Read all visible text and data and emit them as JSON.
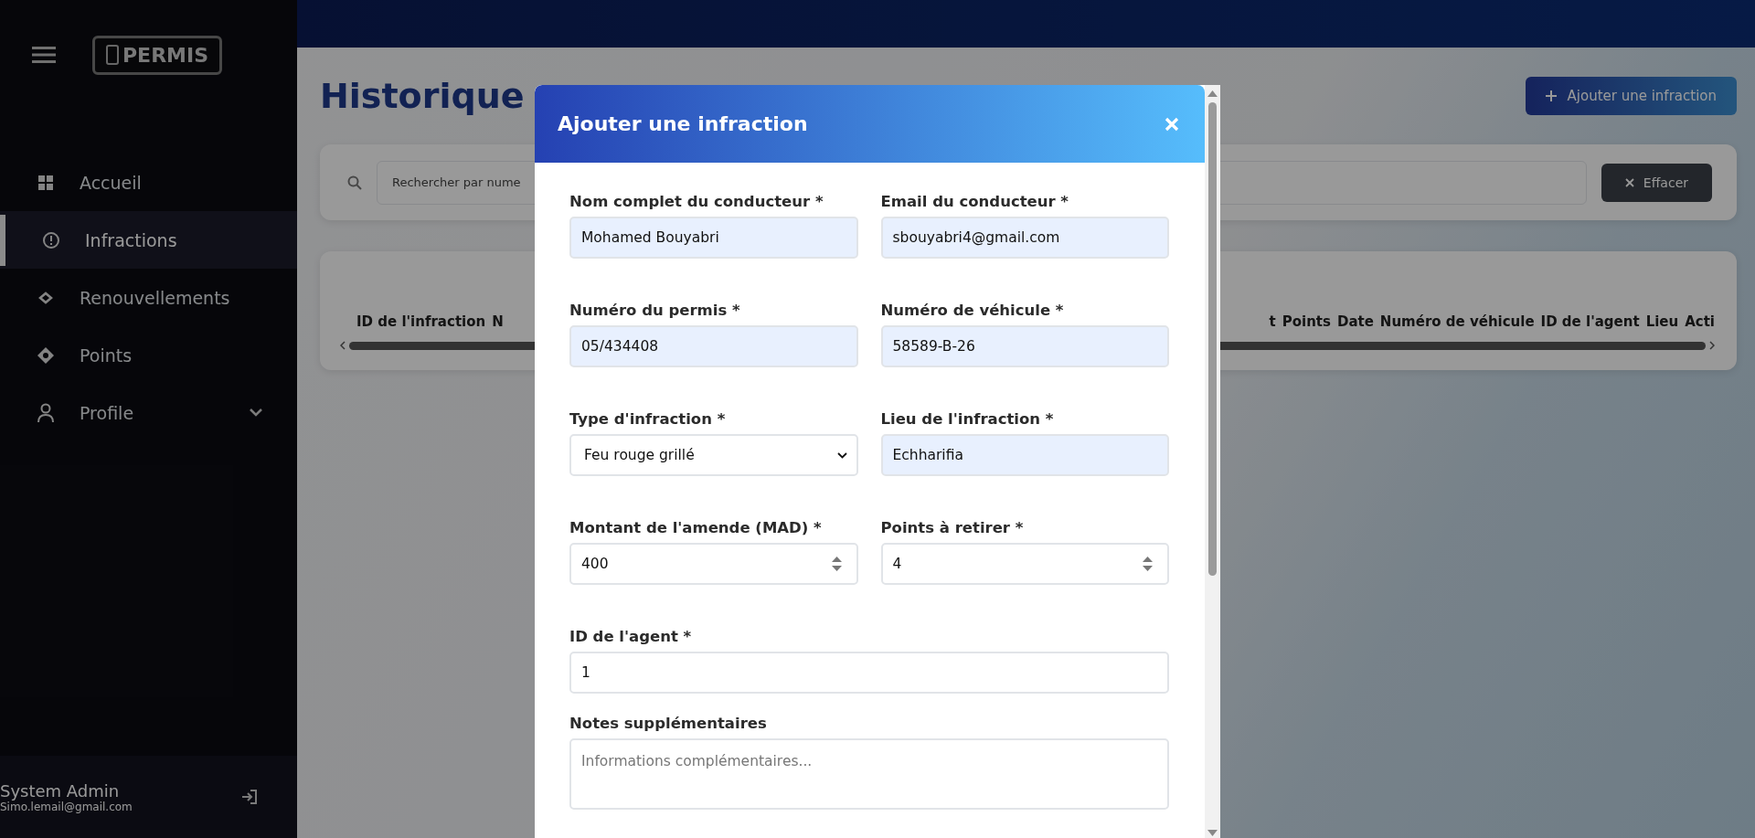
{
  "sidebar": {
    "logo": "PERMIS",
    "items": [
      {
        "label": "Accueil",
        "kind": "link",
        "selected": false
      },
      {
        "label": "Infractions",
        "kind": "link",
        "selected": true
      },
      {
        "label": "Renouvellements",
        "kind": "link",
        "selected": false
      },
      {
        "label": "Points",
        "kind": "link",
        "selected": false
      },
      {
        "label": "Profile",
        "kind": "submenu",
        "selected": false
      }
    ],
    "user": {
      "name": "System Admin",
      "email": "Simo.lemail@gmail.com"
    }
  },
  "page": {
    "title": "Historique",
    "add_button": "Ajouter une infraction",
    "search_placeholder": "Rechercher par nume",
    "clear_button": "Effacer",
    "table": {
      "columns_left": [
        "ID de l'infraction",
        "N"
      ],
      "columns_right": [
        "t",
        "Points",
        "Date",
        "Numéro de véhicule",
        "ID de l'agent",
        "Lieu",
        "Acti"
      ]
    }
  },
  "dialog": {
    "title": "Ajouter une infraction",
    "rows": [
      [
        {
          "label": "Nom complet du conducteur *",
          "kind": "text",
          "value": "Mohamed Bouyabri",
          "autofilled": true
        },
        {
          "label": "Email du conducteur *",
          "kind": "text",
          "value": "sbouyabri4@gmail.com",
          "autofilled": true
        }
      ],
      [
        {
          "label": "Numéro du permis *",
          "kind": "text",
          "value": "05/434408",
          "autofilled": true
        },
        {
          "label": "Numéro de véhicule *",
          "kind": "text",
          "value": "58589-B-26",
          "autofilled": true
        }
      ],
      [
        {
          "label": "Type d'infraction *",
          "kind": "select",
          "value": "Feu rouge grillé",
          "autofilled": false
        },
        {
          "label": "Lieu de l'infraction *",
          "kind": "text",
          "value": "Echharifia",
          "autofilled": true
        }
      ],
      [
        {
          "label": "Montant de l'amende (MAD) *",
          "kind": "number",
          "value": "400",
          "autofilled": false
        },
        {
          "label": "Points à retirer *",
          "kind": "number",
          "value": "4",
          "autofilled": false
        }
      ],
      [
        {
          "label": "ID de l'agent *",
          "kind": "number-plain",
          "value": "1",
          "autofilled": false
        }
      ],
      [
        {
          "label": "Notes supplémentaires",
          "kind": "textarea",
          "placeholder": "Informations complémentaires...",
          "autofilled": false
        }
      ]
    ]
  }
}
